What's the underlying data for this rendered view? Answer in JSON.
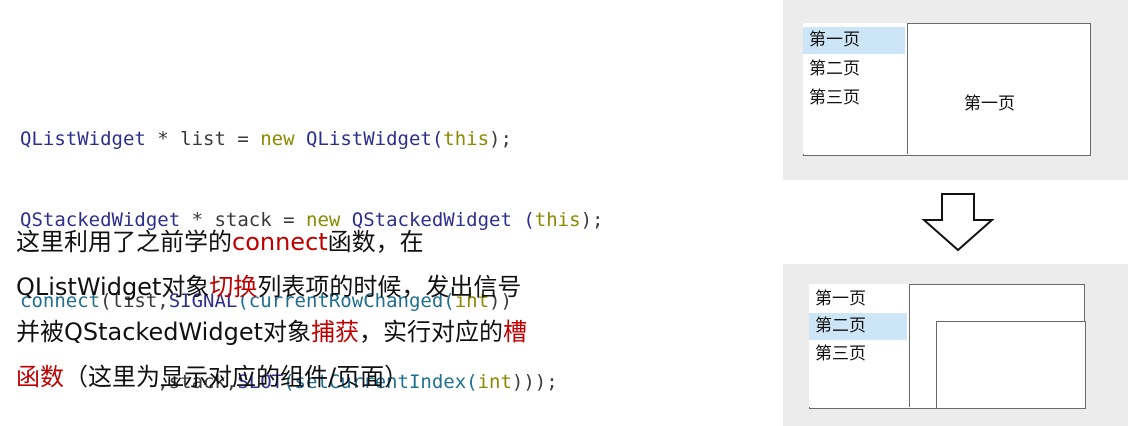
{
  "code": {
    "line1": {
      "type": "QListWidget",
      "mid": " * list = ",
      "new": "new",
      "ctor": " QListWidget(",
      "this": "this",
      "end": ");"
    },
    "line2": {
      "type": "QStackedWidget",
      "mid": " * stack = ",
      "new": "new",
      "ctor": " QStackedWidget (",
      "this": "this",
      "end": ");"
    },
    "line3": {
      "fn": "connect",
      "a": "(list,",
      "macro": "SIGNAL",
      "b": "(currentRowChanged(",
      "kw": "int",
      "c": "))"
    },
    "line4": {
      "a": "            ,stack,",
      "macro": "SLOT",
      "b": "(setCurrentIndex(",
      "kw": "int",
      "c": ")));"
    }
  },
  "description": {
    "l1a": "这里利用了之前学的",
    "l1b": "connect",
    "l1c": "函数，在",
    "l2a": "QListWidget对象",
    "l2b": "切换",
    "l2c": "列表项的时候，发出信号",
    "l3a": "并被QStackedWidget对象",
    "l3b": "捕获",
    "l3c": "，实行对应的",
    "l3d": "槽",
    "l4a": "函数",
    "l4b": "（这里为显示对应的组件/页面）"
  },
  "demo_top": {
    "items": [
      "第一页",
      "第二页",
      "第三页"
    ],
    "selected": 0,
    "page_label": "第一页"
  },
  "demo_bottom": {
    "items": [
      "第一页",
      "第二页",
      "第三页"
    ],
    "selected": 1
  },
  "colors": {
    "highlight": "#c00000",
    "selection": "#cde6f7"
  }
}
